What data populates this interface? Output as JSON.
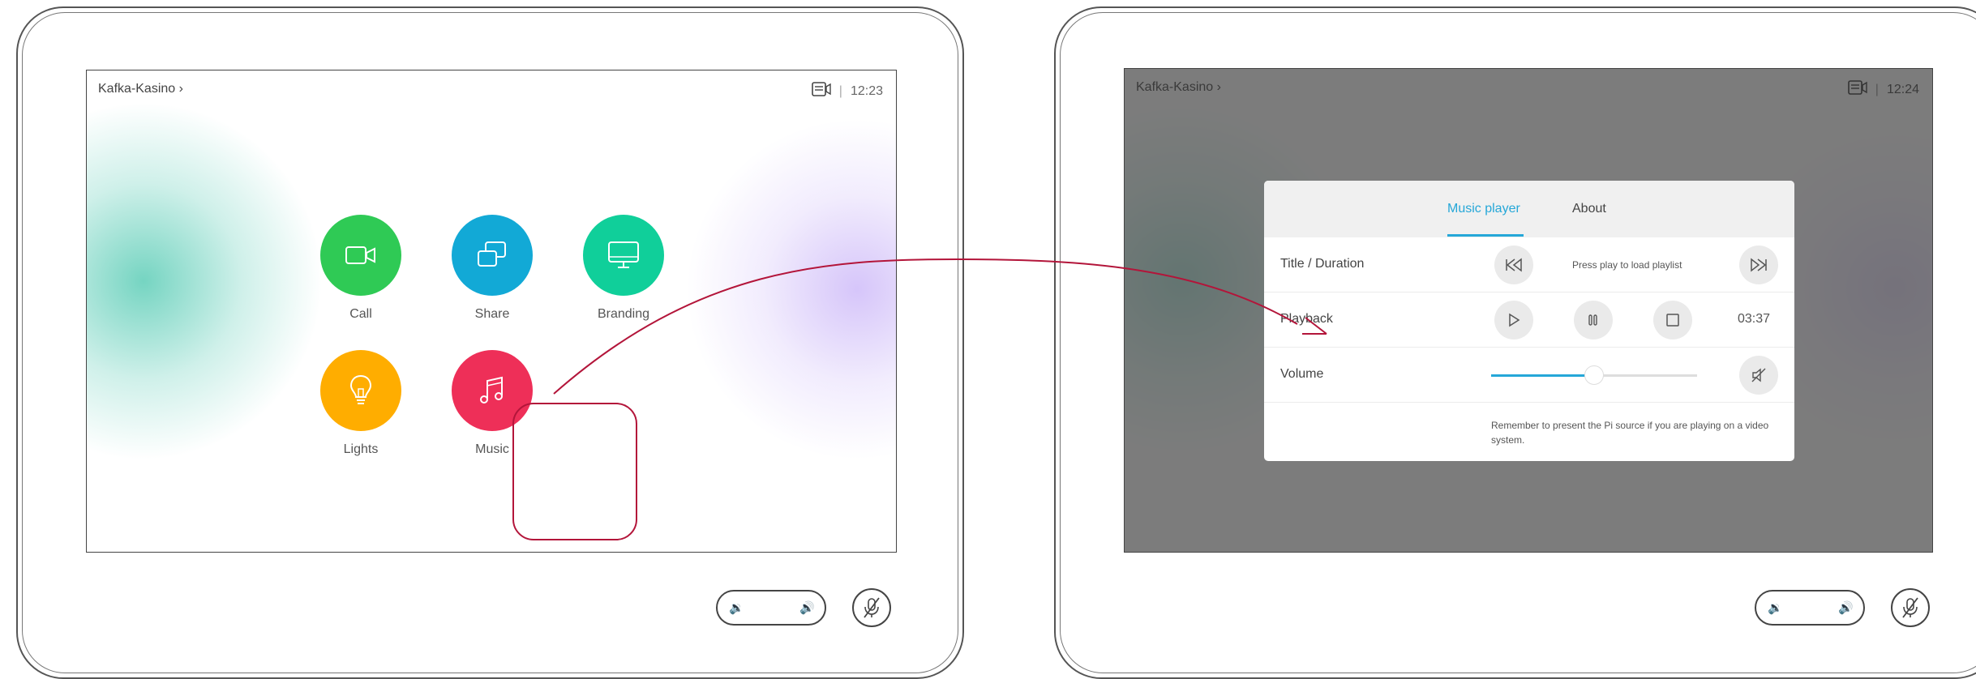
{
  "left": {
    "room_name": "Kafka-Kasino",
    "time": "12:23",
    "tiles": [
      {
        "label": "Call",
        "color": "#2fca55",
        "icon": "camera-icon"
      },
      {
        "label": "Share",
        "color": "#12a9d6",
        "icon": "share-screens-icon"
      },
      {
        "label": "Branding",
        "color": "#10cf9a",
        "icon": "monitor-icon"
      },
      {
        "label": "Lights",
        "color": "#ffad00",
        "icon": "lightbulb-icon"
      },
      {
        "label": "Music",
        "color": "#ee2f58",
        "icon": "music-note-icon"
      }
    ]
  },
  "right": {
    "room_name": "Kafka-Kasino",
    "time": "12:24",
    "dialog": {
      "tabs": [
        {
          "label": "Music player",
          "active": true
        },
        {
          "label": "About",
          "active": false
        }
      ],
      "rows": {
        "title_duration": {
          "label": "Title / Duration",
          "status": "Press play to load playlist"
        },
        "playback": {
          "label": "Playback",
          "time": "03:37"
        },
        "volume": {
          "label": "Volume",
          "level": 0.5
        }
      },
      "note": "Remember to present the Pi source if you are playing on a video system."
    }
  },
  "colors": {
    "accent": "#25a7d8",
    "highlight": "#b3153a"
  }
}
